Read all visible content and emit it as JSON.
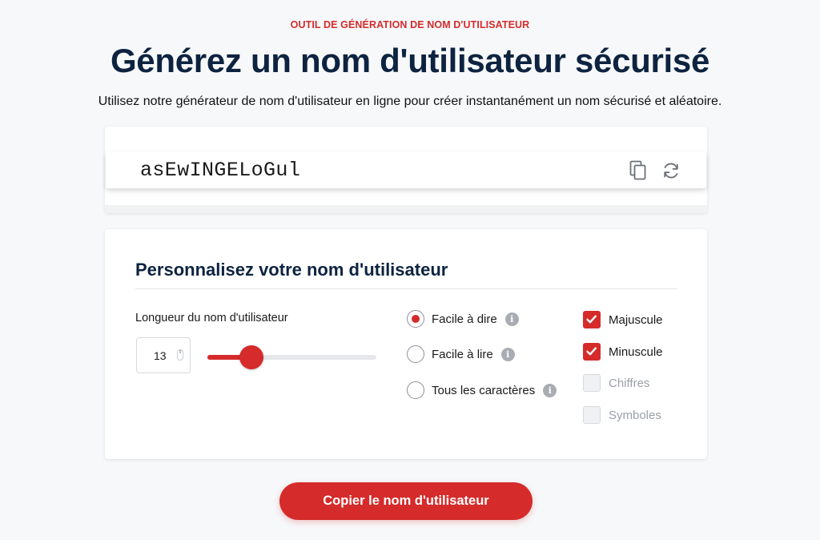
{
  "header": {
    "eyebrow": "OUTIL DE GÉNÉRATION DE NOM D'UTILISATEUR",
    "title": "Générez un nom d'utilisateur sécurisé",
    "subtitle": "Utilisez notre générateur de nom d'utilisateur en ligne pour créer instantanément un nom sécurisé et aléatoire."
  },
  "result": {
    "username": "asEwINGELoGul",
    "copy_icon": "copy-icon",
    "refresh_icon": "refresh-icon"
  },
  "options": {
    "title": "Personnalisez votre nom d'utilisateur",
    "length_label": "Longueur du nom d'utilisateur",
    "length_value": "13",
    "slider": {
      "min": 3,
      "max": 50,
      "value": 13,
      "fill_fraction": 0.26
    },
    "radios": [
      {
        "label": "Facile à dire",
        "checked": true,
        "info_icon": "info-icon"
      },
      {
        "label": "Facile à lire",
        "checked": false,
        "info_icon": "info-icon"
      },
      {
        "label": "Tous les caractères",
        "checked": false,
        "info_icon": "info-icon"
      }
    ],
    "checkboxes": [
      {
        "label": "Majuscule",
        "checked": true,
        "disabled": false
      },
      {
        "label": "Minuscule",
        "checked": true,
        "disabled": false
      },
      {
        "label": "Chiffres",
        "checked": false,
        "disabled": true
      },
      {
        "label": "Symboles",
        "checked": false,
        "disabled": true
      }
    ]
  },
  "cta": {
    "label": "Copier le nom d'utilisateur"
  },
  "colors": {
    "accent": "#d52b2b",
    "navy": "#0d2340",
    "background": "#f7f8fa"
  }
}
